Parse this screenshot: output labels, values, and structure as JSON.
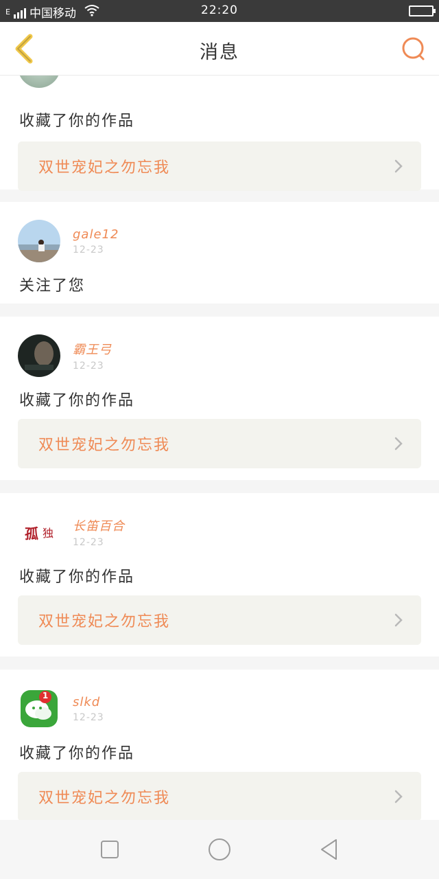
{
  "status_bar": {
    "carrier": "中国移动",
    "carrier_prefix": "E",
    "time": "22:20",
    "icons": [
      "signal-icon",
      "wifi-icon",
      "battery-icon"
    ]
  },
  "header": {
    "title": "消息",
    "back_icon": "back-chevron-icon",
    "search_icon": "search-icon"
  },
  "messages": [
    {
      "username": "",
      "date": "",
      "action": "收藏了你的作品",
      "work": "双世宠妃之勿忘我"
    },
    {
      "username": "gale12",
      "date": "12-23",
      "action": "关注了您",
      "work": ""
    },
    {
      "username": "霸王弓",
      "date": "12-23",
      "action": "收藏了你的作品",
      "work": "双世宠妃之勿忘我"
    },
    {
      "username": "长笛百合",
      "date": "12-23",
      "action": "收藏了你的作品",
      "work": "双世宠妃之勿忘我",
      "avatar_text": [
        "孤",
        "独"
      ]
    },
    {
      "username": "slkd",
      "date": "12-23",
      "action": "收藏了你的作品",
      "work": "双世宠妃之勿忘我",
      "avatar_badge": "1"
    }
  ],
  "nav_bar": {
    "icons": [
      "recent-apps-icon",
      "home-icon",
      "back-icon"
    ]
  },
  "colors": {
    "accent": "#ef8a55",
    "back_chevron": "#f0c84a",
    "card_link_bg": "#f3f3ee",
    "page_bg": "#f5f5f5"
  }
}
